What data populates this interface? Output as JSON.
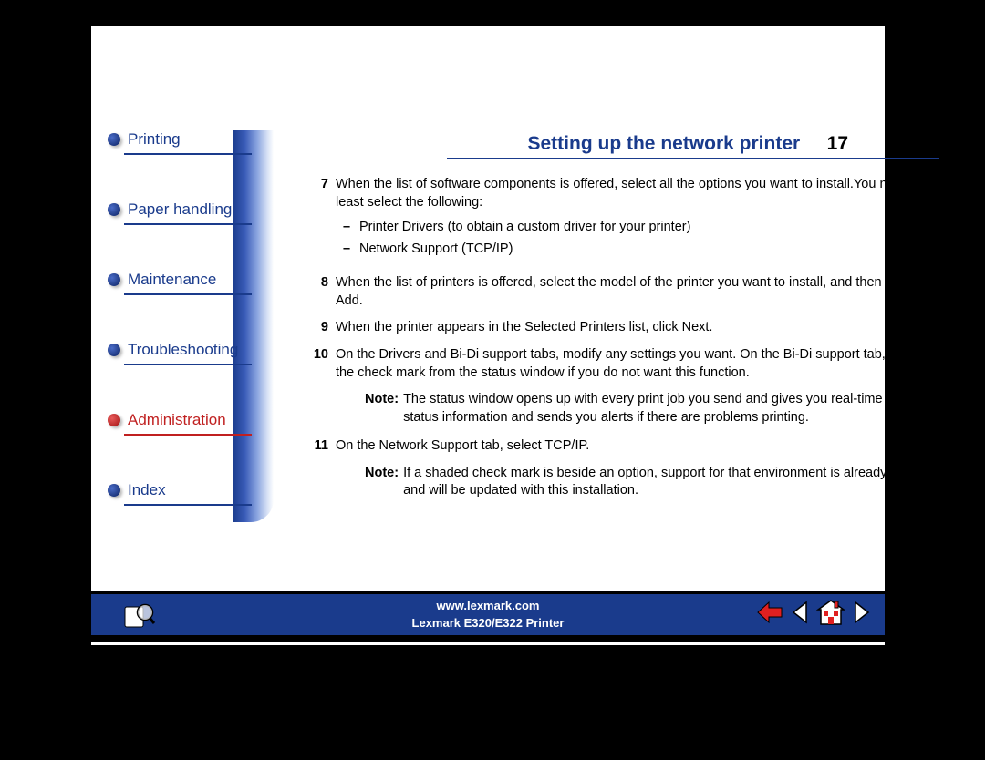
{
  "header": {
    "title": "Setting up the network printer",
    "page_number": "17"
  },
  "sidebar": {
    "items": [
      {
        "label": "Printing",
        "active": false
      },
      {
        "label": "Paper handling",
        "active": false
      },
      {
        "label": "Maintenance",
        "active": false
      },
      {
        "label": "Troubleshooting",
        "active": false
      },
      {
        "label": "Administration",
        "active": true
      },
      {
        "label": "Index",
        "active": false
      }
    ]
  },
  "content": {
    "steps": [
      {
        "num": "7",
        "text": "When the list of software components is offered, select all the options you want to install.You need to at least select the following:",
        "sublist": [
          "Printer Drivers (to obtain a custom driver for your printer)",
          "Network Support (TCP/IP)"
        ]
      },
      {
        "num": "8",
        "text": "When the list of printers is offered, select the model of the printer you want to install, and then click Add."
      },
      {
        "num": "9",
        "text": "When the printer appears in the Selected Printers list, click Next."
      },
      {
        "num": "10",
        "text": "On the Drivers and Bi-Di support tabs, modify any settings you want. On the Bi-Di support tab, remove the check mark from the status window if you do not want this function.",
        "note": "The status window opens up with every print job you send and gives you real-time job status information and sends you alerts if there are problems printing."
      },
      {
        "num": "11",
        "text": "On the Network Support tab, select TCP/IP.",
        "note": "If a shaded check mark is beside an option, support for that environment is already installed and will be updated with this installation."
      }
    ],
    "note_label": "Note:"
  },
  "footer": {
    "url": "www.lexmark.com",
    "product": "Lexmark E320/E322 Printer"
  }
}
